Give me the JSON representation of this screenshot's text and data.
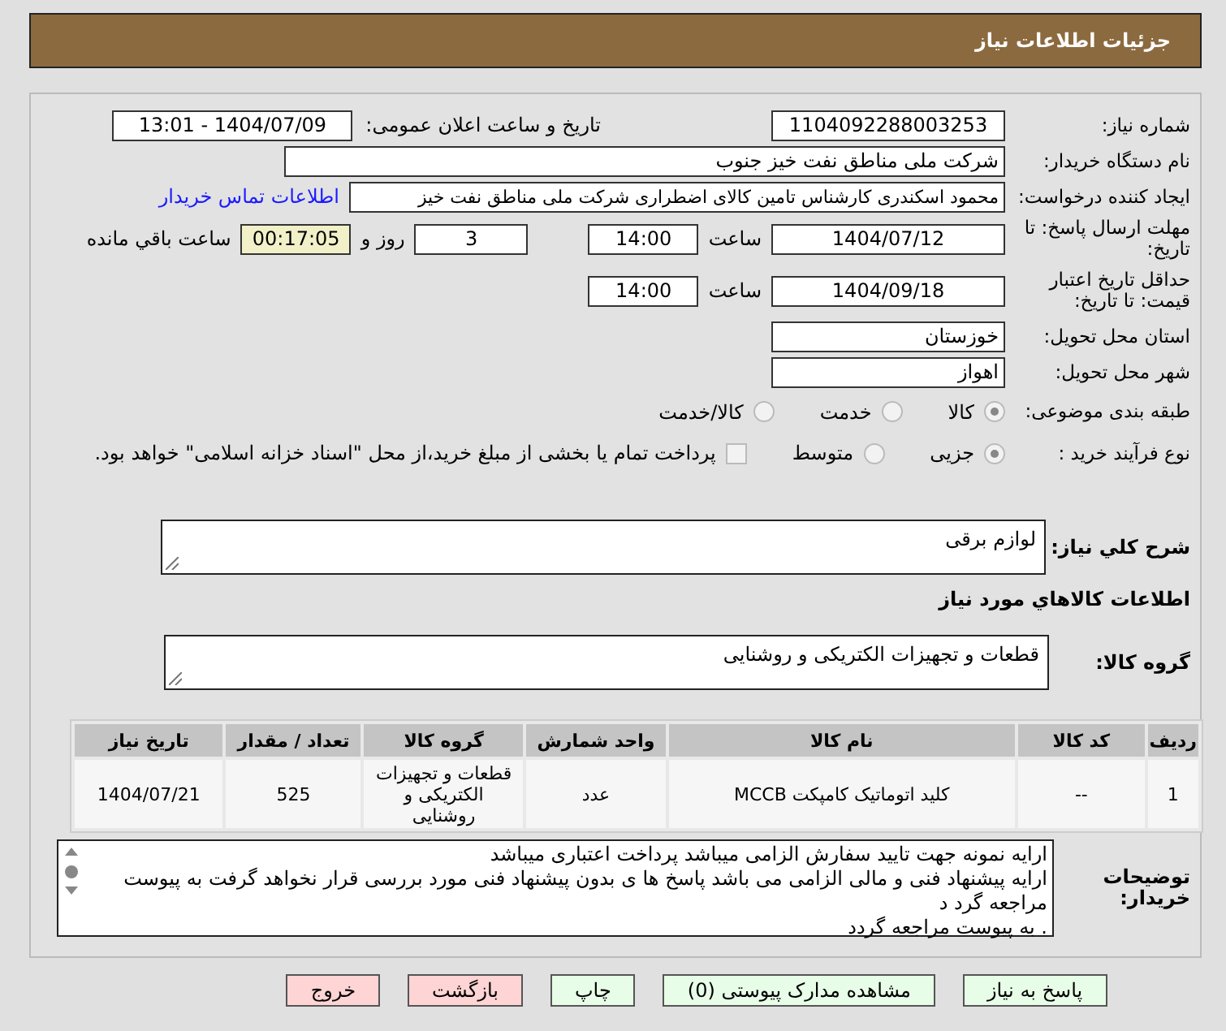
{
  "header": {
    "title": "جزئیات اطلاعات نیاز"
  },
  "need_number": {
    "label": "شماره نیاز:",
    "value": "1104092288003253"
  },
  "announce": {
    "label": "تاریخ و ساعت اعلان عمومی:",
    "value": "1404/07/09 - 13:01"
  },
  "buyer": {
    "label": "نام دستگاه خریدار:",
    "value": "شرکت ملی مناطق نفت خیز جنوب"
  },
  "creator": {
    "label": "ایجاد کننده درخواست:",
    "value": "محمود  اسکندری کارشناس تامین کالای اضطراری شرکت ملی مناطق نفت خیز",
    "link": "اطلاعات تماس خریدار"
  },
  "deadline": {
    "label": "مهلت ارسال پاسخ: تا تاریخ:",
    "date": "1404/07/12",
    "time_label": "ساعت",
    "time": "14:00",
    "days": "3",
    "days_label": "روز و",
    "remaining": "00:17:05",
    "remaining_label": "ساعت باقي مانده"
  },
  "validity": {
    "label": "حداقل تاریخ اعتبار قیمت: تا تاریخ:",
    "date": "1404/09/18",
    "time_label": "ساعت",
    "time": "14:00"
  },
  "province": {
    "label": "استان محل تحویل:",
    "value": "خوزستان"
  },
  "city": {
    "label": "شهر محل تحویل:",
    "value": "اهواز"
  },
  "category": {
    "label": "طبقه بندی موضوعی:",
    "options": [
      {
        "label": "کالا",
        "selected": true
      },
      {
        "label": "خدمت",
        "selected": false
      },
      {
        "label": "کالا/خدمت",
        "selected": false
      }
    ]
  },
  "process": {
    "label": "نوع فرآیند خرید :",
    "options": [
      {
        "label": "جزیی",
        "selected": true
      },
      {
        "label": "متوسط",
        "selected": false
      }
    ],
    "payment": {
      "label": "پرداخت تمام یا بخشی از مبلغ خرید،از محل \"اسناد خزانه اسلامی\" خواهد بود.",
      "checked": false
    }
  },
  "description": {
    "label": "شرح کلي نياز:",
    "value": "لوازم برقی"
  },
  "goods_title": "اطلاعات کالاهاي مورد نياز",
  "goods_group": {
    "label": "گروه کالا:",
    "value": "قطعات و تجهیزات الکتریکی و روشنایی"
  },
  "table": {
    "columns": [
      "ردیف",
      "کد کالا",
      "نام کالا",
      "واحد شمارش",
      "گروه کالا",
      "تعداد / مقدار",
      "تاریخ نیاز"
    ],
    "rows": [
      {
        "cells": [
          "1",
          "--",
          "کلید اتوماتیک کامپکت MCCB",
          "عدد",
          "قطعات و تجهیزات الکتریکی و روشنایی",
          "525",
          "1404/07/21"
        ]
      }
    ]
  },
  "buyer_notes": {
    "label": "توضیحات خریدار:",
    "lines": [
      "ارایه نمونه جهت تایید سفارش الزامی میباشد پرداخت اعتباری میباشد",
      "ارایه پیشنهاد فنی و مالی الزامی می باشد پاسخ ها ی بدون پیشنهاد فنی مورد بررسی قرار نخواهد گرفت به پیوست مراجعه گرد د",
      ". به پیوست مراجعه گردد"
    ]
  },
  "buttons": [
    {
      "label": "پاسخ به نیاز",
      "kind": "action"
    },
    {
      "label": "مشاهده مدارک پیوستی (0)",
      "kind": "action"
    },
    {
      "label": "چاپ",
      "kind": "action"
    },
    {
      "label": "بازگشت",
      "kind": "danger"
    },
    {
      "label": "خروج",
      "kind": "danger"
    }
  ]
}
